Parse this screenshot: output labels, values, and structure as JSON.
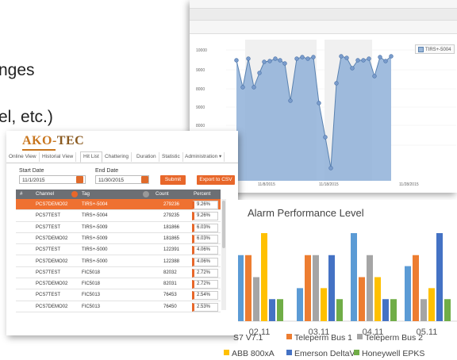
{
  "background_text": {
    "line1": "nges",
    "line2": "el, etc.)"
  },
  "trend_window": {
    "legend_label": "TIRS+-5004",
    "y_ticks": [
      "10000",
      "9000",
      "8000",
      "9000",
      "8000",
      "7000"
    ],
    "x_ticks": [
      "11/8/2015",
      "11/18/2015",
      "11/28/2015"
    ],
    "fill_color": "#8fb0d8",
    "line_color": "#5a82b0"
  },
  "app": {
    "logo": {
      "part1": "AKO-",
      "part2": "TEC"
    },
    "tabs": [
      {
        "label": "Online View"
      },
      {
        "label": "Historial View"
      },
      {
        "label": "Hit List"
      },
      {
        "label": "Chattering"
      },
      {
        "label": "Duration"
      },
      {
        "label": "Statistic"
      },
      {
        "label": "Administration ▾"
      }
    ],
    "start_date": {
      "label": "Start Date",
      "value": "11/1/2015"
    },
    "end_date": {
      "label": "End Date",
      "value": "11/30/2015"
    },
    "submit_label": "Submit",
    "export_label": "Export to CSV",
    "columns": {
      "num": "#",
      "channel": "Channel",
      "tag": "Tag",
      "count": "Count",
      "percent": "Percent"
    },
    "rows": [
      {
        "channel": "PCS7DEMO02",
        "tag": "TIRS+-5004",
        "count": "279236",
        "percent": "9.26%"
      },
      {
        "channel": "PCS7TEST",
        "tag": "TIRS+-5004",
        "count": "279235",
        "percent": "9.26%"
      },
      {
        "channel": "PCS7TEST",
        "tag": "TIRS+-5009",
        "count": "181866",
        "percent": "6.03%"
      },
      {
        "channel": "PCS7DEMO02",
        "tag": "TIRS+-5009",
        "count": "181865",
        "percent": "6.03%"
      },
      {
        "channel": "PCS7TEST",
        "tag": "TIRS+-5000",
        "count": "122391",
        "percent": "4.06%"
      },
      {
        "channel": "PCS7DEMO02",
        "tag": "TIRS+-5000",
        "count": "122388",
        "percent": "4.06%"
      },
      {
        "channel": "PCS7TEST",
        "tag": "FIC5018",
        "count": "82032",
        "percent": "2.72%"
      },
      {
        "channel": "PCS7DEMO02",
        "tag": "FIC5018",
        "count": "82031",
        "percent": "2.72%"
      },
      {
        "channel": "PCS7TEST",
        "tag": "FIC5013",
        "count": "76453",
        "percent": "2.54%"
      },
      {
        "channel": "PCS7DEMO02",
        "tag": "FIC5013",
        "count": "76450",
        "percent": "2.53%"
      }
    ]
  },
  "chart_data": {
    "type": "bar",
    "title": "Alarm Performance Level",
    "categories": [
      "02.11",
      "03.11",
      "04.11",
      "05.11"
    ],
    "series": [
      {
        "name": "S7 V7.1",
        "color": "#5b9bd5",
        "values": [
          6,
          3,
          8,
          5
        ]
      },
      {
        "name": "Teleperm Bus 1",
        "color": "#ed7d31",
        "values": [
          6,
          6,
          4,
          6
        ]
      },
      {
        "name": "Teleperm Bus 2",
        "color": "#a5a5a5",
        "values": [
          4,
          6,
          6,
          2
        ]
      },
      {
        "name": "ABB 800xA",
        "color": "#ffc000",
        "values": [
          8,
          3,
          4,
          3
        ]
      },
      {
        "name": "Emerson DeltaV",
        "color": "#4472c4",
        "values": [
          2,
          6,
          2,
          8
        ]
      },
      {
        "name": "Honeywell EPKS",
        "color": "#70ad47",
        "values": [
          2,
          2,
          2,
          2
        ]
      }
    ],
    "legend_labels": [
      "S7 V7.1",
      "Teleperm Bus 1",
      "Teleperm Bus 2",
      "ABB 800xA",
      "Emerson DeltaV",
      "Honeywell EPKS"
    ],
    "ylim": [
      0,
      8
    ],
    "grid": false,
    "legend_position": "bottom"
  }
}
